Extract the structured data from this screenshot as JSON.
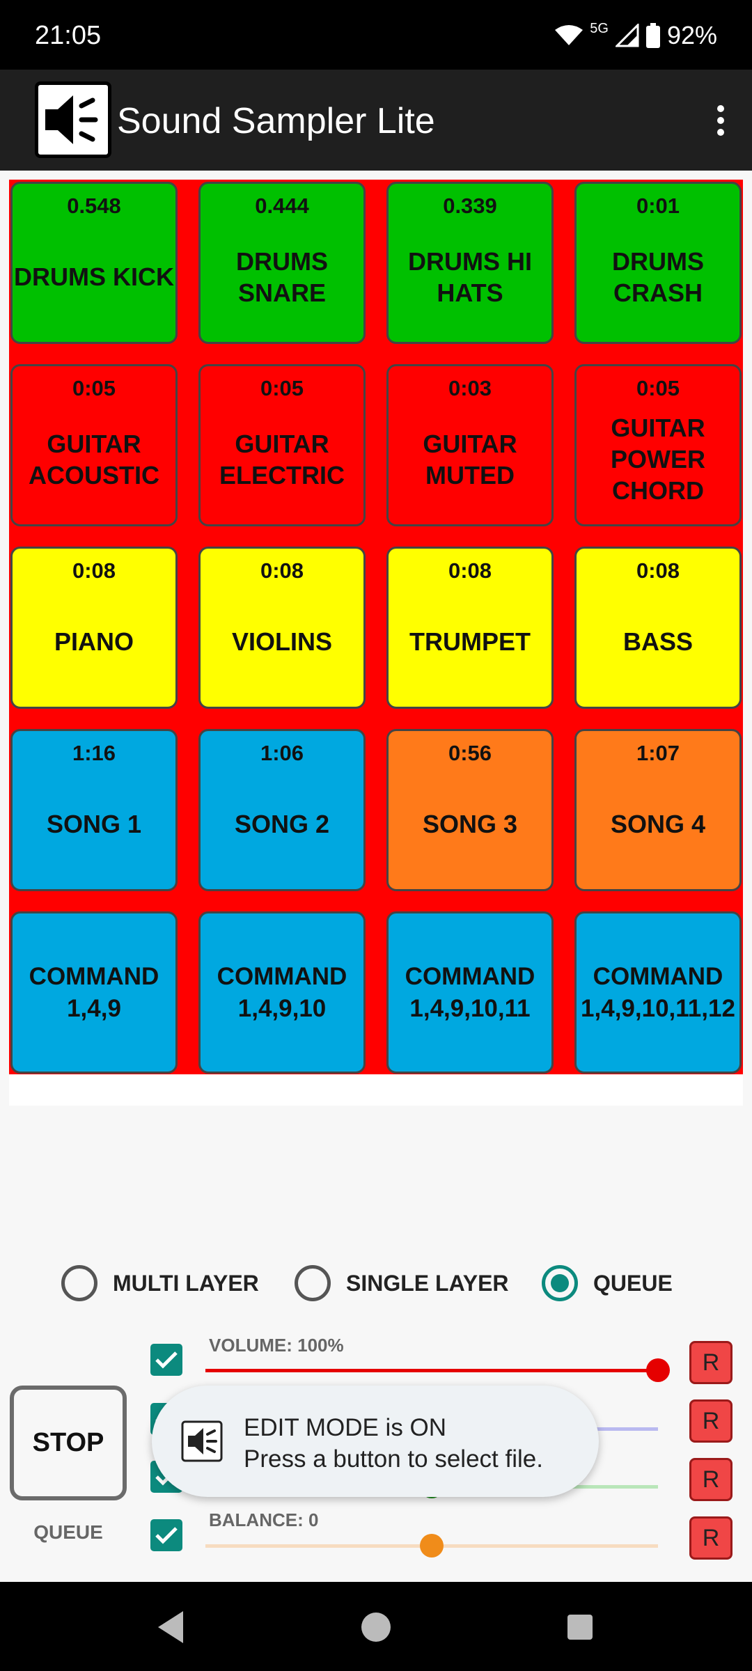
{
  "status_bar": {
    "time": "21:05",
    "network": "5G",
    "battery": "92%"
  },
  "app_bar": {
    "title": "Sound Sampler Lite"
  },
  "colors": {
    "green": "#00c000",
    "red": "#ff0000",
    "yellow": "#ffff00",
    "blue": "#00a8e0",
    "orange": "#ff7a1a",
    "teal": "#0c8a7e"
  },
  "pads": [
    {
      "duration": "0.548",
      "name": "DRUMS KICK",
      "color": "#00c000"
    },
    {
      "duration": "0.444",
      "name": "DRUMS SNARE",
      "color": "#00c000"
    },
    {
      "duration": "0.339",
      "name": "DRUMS HI HATS",
      "color": "#00c000"
    },
    {
      "duration": "0:01",
      "name": "DRUMS CRASH",
      "color": "#00c000"
    },
    {
      "duration": "0:05",
      "name": "GUITAR ACOUSTIC",
      "color": "#ff0000"
    },
    {
      "duration": "0:05",
      "name": "GUITAR ELECTRIC",
      "color": "#ff0000"
    },
    {
      "duration": "0:03",
      "name": "GUITAR MUTED",
      "color": "#ff0000"
    },
    {
      "duration": "0:05",
      "name": "GUITAR POWER CHORD",
      "color": "#ff0000"
    },
    {
      "duration": "0:08",
      "name": "PIANO",
      "color": "#ffff00"
    },
    {
      "duration": "0:08",
      "name": "VIOLINS",
      "color": "#ffff00"
    },
    {
      "duration": "0:08",
      "name": "TRUMPET",
      "color": "#ffff00"
    },
    {
      "duration": "0:08",
      "name": "BASS",
      "color": "#ffff00"
    },
    {
      "duration": "1:16",
      "name": "SONG 1",
      "color": "#00a8e0"
    },
    {
      "duration": "1:06",
      "name": "SONG 2",
      "color": "#00a8e0"
    },
    {
      "duration": "0:56",
      "name": "SONG 3",
      "color": "#ff7a1a"
    },
    {
      "duration": "1:07",
      "name": "SONG 4",
      "color": "#ff7a1a"
    },
    {
      "duration": "",
      "name": "COMMAND 1,4,9",
      "color": "#00a8e0"
    },
    {
      "duration": "",
      "name": "COMMAND 1,4,9,10",
      "color": "#00a8e0"
    },
    {
      "duration": "",
      "name": "COMMAND 1,4,9,10,11",
      "color": "#00a8e0"
    },
    {
      "duration": "",
      "name": "COMMAND 1,4,9,10,11,12",
      "color": "#00a8e0"
    }
  ],
  "modes": {
    "multi_layer": "MULTI LAYER",
    "single_layer": "SINGLE LAYER",
    "queue": "QUEUE",
    "selected": "queue"
  },
  "controls": {
    "stop_label": "STOP",
    "mode_label": "QUEUE",
    "volume_label": "VOLUME: 100%",
    "volume_value": 1.0,
    "balance_label": "BALANCE: 0",
    "balance_value": 0.5,
    "slider2_value": 0.5,
    "reset_label": "R"
  },
  "toast": {
    "line1": "EDIT MODE is ON",
    "line2": "Press a button to select file."
  }
}
